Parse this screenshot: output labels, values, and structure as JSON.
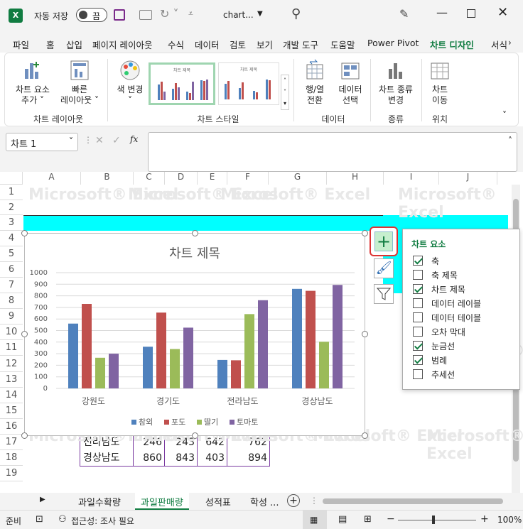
{
  "titlebar": {
    "autosave_label": "자동 저장",
    "toggle_state": "끔",
    "filename": "chart...",
    "icons": [
      "excel-logo",
      "save-icon",
      "camera-icon",
      "redo-icon",
      "search-icon",
      "pen-icon",
      "minimize-icon",
      "maximize-icon",
      "close-icon"
    ]
  },
  "tabs": [
    "파일",
    "홈",
    "삽입",
    "페이지 레이아웃",
    "수식",
    "데이터",
    "검토",
    "보기",
    "개발 도구",
    "도움말",
    "Power Pivot",
    "차트 디자인",
    "서식"
  ],
  "active_tab": "차트 디자인",
  "ribbon": {
    "add_element": "차트 요소\n추가 ˅",
    "quick_layout": "빠른\n레이아웃 ˅",
    "layout_group": "차트 레이아웃",
    "change_color": "색 변경",
    "style_group": "차트 스타일",
    "style_thumb_title": "차트 제목",
    "switch_rowcol": "행/열\n전환",
    "select_data": "데이터\n선택",
    "data_group": "데이터",
    "change_type": "차트 종류\n변경",
    "type_group": "종류",
    "move_chart": "차트\n이동",
    "location_group": "위치"
  },
  "formula": {
    "namebox": "차트 1",
    "fx": "fx"
  },
  "columns": [
    "A",
    "B",
    "C",
    "D",
    "E",
    "F",
    "G",
    "H",
    "I",
    "J"
  ],
  "rows": [
    "1",
    "2",
    "3",
    "4",
    "5",
    "6",
    "7",
    "8",
    "9",
    "10",
    "11",
    "12",
    "13",
    "14",
    "15",
    "16",
    "17",
    "18",
    "19"
  ],
  "table_rows": [
    {
      "region": "전라남도",
      "v1": "246",
      "v2": "243",
      "v3": "642",
      "v4": "762"
    },
    {
      "region": "경상남도",
      "v1": "860",
      "v2": "843",
      "v3": "403",
      "v4": "894"
    }
  ],
  "watermark": "Microsoft® Excel",
  "chart_data": {
    "type": "bar",
    "title": "차트 제목",
    "categories": [
      "강원도",
      "경기도",
      "전라남도",
      "경상남도"
    ],
    "series": [
      {
        "name": "참외",
        "color": "#4f81bd",
        "values": [
          560,
          360,
          246,
          860
        ]
      },
      {
        "name": "포도",
        "color": "#c0504d",
        "values": [
          730,
          655,
          243,
          843
        ]
      },
      {
        "name": "딸기",
        "color": "#9bbb59",
        "values": [
          265,
          340,
          642,
          403
        ]
      },
      {
        "name": "토마토",
        "color": "#8064a2",
        "values": [
          300,
          525,
          762,
          894
        ]
      }
    ],
    "ylim": [
      0,
      1000
    ],
    "yticks": [
      "0",
      "100",
      "200",
      "300",
      "400",
      "500",
      "600",
      "700",
      "800",
      "900",
      "1000"
    ],
    "grid": true,
    "legend": "bottom"
  },
  "panel": {
    "title": "차트 요소",
    "items": [
      {
        "label": "축",
        "checked": true
      },
      {
        "label": "축 제목",
        "checked": false
      },
      {
        "label": "차트 제목",
        "checked": true
      },
      {
        "label": "데이터 레이블",
        "checked": false
      },
      {
        "label": "데이터 테이블",
        "checked": false
      },
      {
        "label": "오차 막대",
        "checked": false
      },
      {
        "label": "눈금선",
        "checked": true
      },
      {
        "label": "범례",
        "checked": true
      },
      {
        "label": "추세선",
        "checked": false
      }
    ]
  },
  "sheets": [
    "과일수확량",
    "과일판매량",
    "성적표",
    "학성 ..."
  ],
  "active_sheet": "과일판매량",
  "status": {
    "ready": "준비",
    "accessibility": "접근성: 조사 필요",
    "zoom": "100%"
  }
}
